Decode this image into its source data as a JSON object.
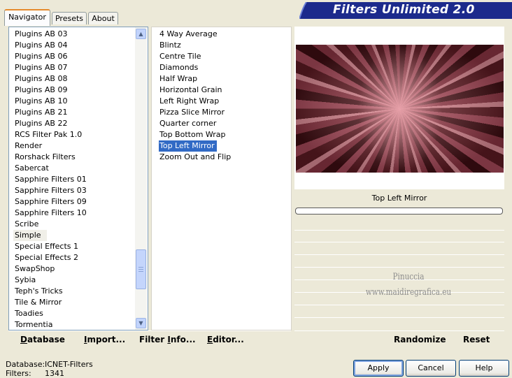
{
  "app": {
    "title": "Filters Unlimited 2.0"
  },
  "tabs": [
    {
      "label": "Navigator",
      "active": true
    },
    {
      "label": "Presets",
      "active": false
    },
    {
      "label": "About",
      "active": false
    }
  ],
  "categories": {
    "items": [
      "Plugins AB 03",
      "Plugins AB 04",
      "Plugins AB 06",
      "Plugins AB 07",
      "Plugins AB 08",
      "Plugins AB 09",
      "Plugins AB 10",
      "Plugins AB 21",
      "Plugins AB 22",
      "RCS Filter Pak 1.0",
      "Render",
      "Rorshack Filters",
      "Sabercat",
      "Sapphire Filters 01",
      "Sapphire Filters 03",
      "Sapphire Filters 09",
      "Sapphire Filters 10",
      "Scribe",
      "Simple",
      "Special Effects 1",
      "Special Effects 2",
      "SwapShop",
      "Sybia",
      "Teph's Tricks",
      "Tile & Mirror",
      "Toadies",
      "Tormentia"
    ],
    "selected": "Simple"
  },
  "filters": {
    "items": [
      "4 Way Average",
      "Blintz",
      "Centre Tile",
      "Diamonds",
      "Half Wrap",
      "Horizontal Grain",
      "Left Right Wrap",
      "Pizza Slice Mirror",
      "Quarter corner",
      "Top Bottom Wrap",
      "Top Left Mirror",
      "Zoom Out and Flip"
    ],
    "selected": "Top Left Mirror"
  },
  "preview": {
    "filter_name": "Top Left Mirror",
    "progress": 0,
    "watermark_line1": "Pinuccia",
    "watermark_line2": "www.maidiregrafica.eu"
  },
  "toolbar": {
    "database": {
      "u": "D",
      "rest": "atabase"
    },
    "import": {
      "u": "I",
      "rest": "mport..."
    },
    "filter_info": {
      "u": "",
      "pre": "Filter ",
      "u2": "I",
      "rest": "nfo..."
    },
    "editor": {
      "u": "E",
      "rest": "ditor..."
    },
    "randomize": "Randomize",
    "reset": "Reset"
  },
  "info": {
    "database_label": "Database:",
    "database_value": "ICNET-Filters",
    "filters_label": "Filters:",
    "filters_value": "1341"
  },
  "buttons": {
    "apply": "Apply",
    "cancel": "Cancel",
    "help": "Help"
  },
  "colors": {
    "selection": "#316ac5",
    "banner": "#1c2a8c",
    "window": "#ece9d8"
  }
}
